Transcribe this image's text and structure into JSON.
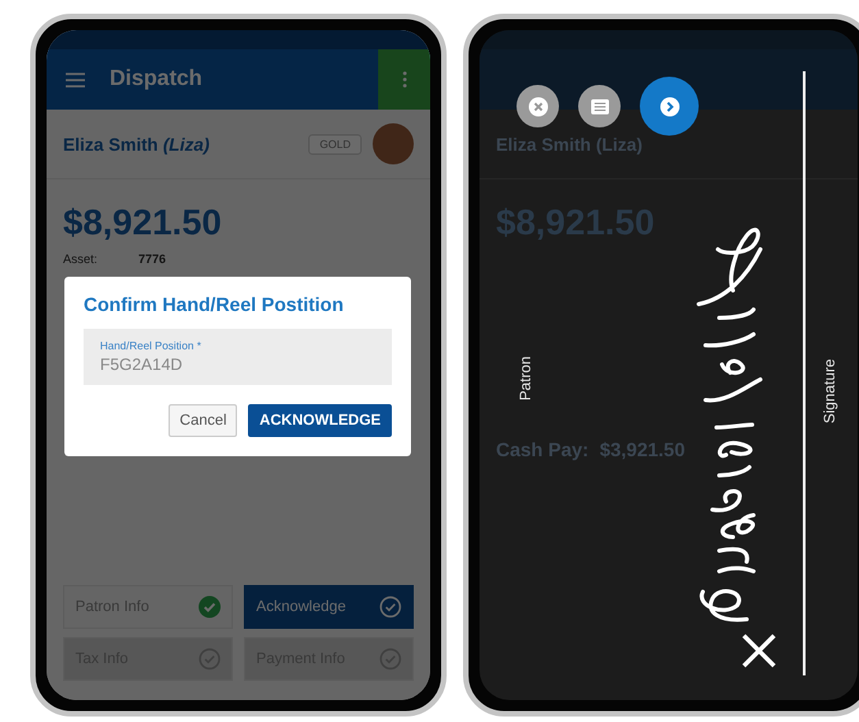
{
  "left_phone": {
    "app_bar": {
      "title": "Dispatch"
    },
    "patron": {
      "name": "Eliza Smith *(Liza)*",
      "tier": "GOLD"
    },
    "amount": "$8,921.50",
    "details": [
      {
        "label": "Asset:",
        "value": "7776"
      }
    ],
    "dialog": {
      "title": "Confirm Hand/Reel Postition",
      "field": {
        "label": "Hand/Reel Position *",
        "value": "F5G2A14D"
      },
      "buttons": [
        {
          "label": "Cancel",
          "kind": "secondary"
        },
        {
          "label": "ACKNOWLEDGE",
          "kind": "primary"
        }
      ]
    },
    "steps": [
      {
        "label": "Patron Info",
        "done": true,
        "selected": false,
        "disabled": false
      },
      {
        "label": "Acknowledge",
        "done": false,
        "selected": true,
        "disabled": false
      },
      {
        "label": "Tax Info",
        "done": false,
        "selected": false,
        "disabled": true
      },
      {
        "label": "Payment Info",
        "done": false,
        "selected": false,
        "disabled": true
      }
    ]
  },
  "right_phone": {
    "patron": {
      "name": "Eliza Smith (Liza)"
    },
    "amount": "$8,921.50",
    "cash_pay": {
      "label": "Cash Pay:",
      "value": "$3,921.50"
    },
    "actions": [
      {
        "kind": "clear",
        "selected": false
      },
      {
        "kind": "list",
        "selected": false
      },
      {
        "kind": "next",
        "selected": true
      }
    ],
    "signature_pad": {
      "left_label": "Patron",
      "right_label": "Signature"
    }
  }
}
